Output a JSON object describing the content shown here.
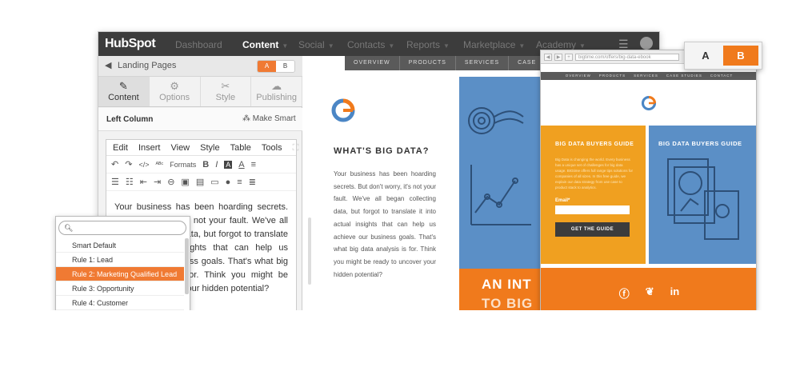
{
  "nav": {
    "logo": "HubSpot",
    "items": [
      {
        "label": "Dashboard",
        "active": false
      },
      {
        "label": "Content",
        "active": true
      },
      {
        "label": "Social",
        "active": false
      },
      {
        "label": "Contacts",
        "active": false
      },
      {
        "label": "Reports",
        "active": false
      },
      {
        "label": "Marketplace",
        "active": false
      },
      {
        "label": "Academy",
        "active": false
      }
    ]
  },
  "sidebar": {
    "back_label": "Landing Pages",
    "ab_a": "A",
    "ab_b": "B",
    "tabs": [
      {
        "label": "Content",
        "icon": "pencil-icon"
      },
      {
        "label": "Options",
        "icon": "gear-icon"
      },
      {
        "label": "Style",
        "icon": "scissors-icon"
      },
      {
        "label": "Publishing",
        "icon": "cloud-icon"
      }
    ],
    "section_title": "Left Column",
    "make_smart": "Make Smart"
  },
  "editor": {
    "menu": [
      "Edit",
      "Insert",
      "View",
      "Style",
      "Table",
      "Tools"
    ],
    "formats_label": "Formats",
    "text": "Your business has been hoarding secrets. But don't worry, it's not your fault. We've all began collecting data, but forgot to translate it into actual insights that can help us achieve our business goals. That's what big data analysis is for. Think you might be ready to uncover your hidden potential?"
  },
  "dropdown": {
    "search_value": "",
    "options": [
      "Smart Default",
      "Rule 1: Lead",
      "Rule 2: Marketing Qualified Lead",
      "Rule 3: Opportunity",
      "Rule 4: Customer"
    ],
    "selected_index": 2
  },
  "preview": {
    "nav": [
      "OVERVIEW",
      "PRODUCTS",
      "SERVICES",
      "CASE"
    ],
    "heading": "WHAT'S BIG DATA?",
    "body": "Your business has been hoarding secrets. But don't worry, it's not your fault. We've all began collecting data, but forgot to translate it into actual insights that can help us achieve our business goals. That's what big data analysis is for. Think you might be ready to uncover your hidden potential?",
    "banner_line1": "AN INT",
    "banner_line2": "TO BIG"
  },
  "browser": {
    "url": "bigtime.com/offers/big-data-ebook",
    "nav": [
      "OVERVIEW",
      "PRODUCTS",
      "SERVICES",
      "CASE STUDIES",
      "CONTACT"
    ],
    "orange_title": "BIG DATA BUYERS GUIDE",
    "orange_body": "Big Data is changing the world. Every business has a unique set of challenges for big data usage. BIGtime offers full range tips solutions for companies of all sizes. In this free guide, we explain our data strategy from use case to product stack to analytics.",
    "email_label": "Email*",
    "email_value": "",
    "cta": "GET THE GUIDE",
    "blue_title": "BIG DATA BUYERS GUIDE",
    "social": [
      "facebook-icon",
      "twitter-icon",
      "linkedin-icon"
    ]
  },
  "ab_big": {
    "a": "A",
    "b": "B"
  },
  "colors": {
    "accent": "#f07a1c",
    "blue": "#5b8fc6",
    "dark": "#3c3c3c"
  }
}
